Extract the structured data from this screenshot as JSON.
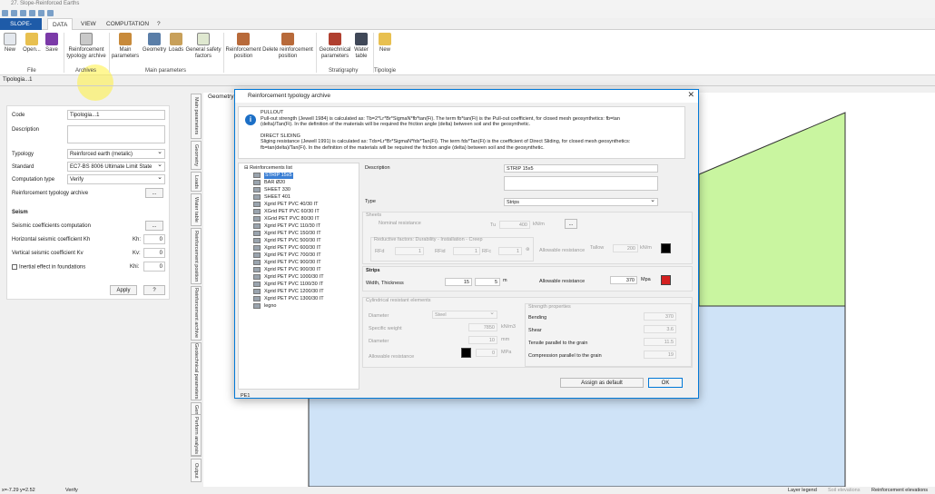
{
  "window": {
    "title": "27. Slope-Reinforced Earths"
  },
  "menu": {
    "file": "SLOPE-M.R.E.",
    "items": [
      "DATA",
      "VIEW",
      "COMPUTATION",
      "?"
    ]
  },
  "ribbon": {
    "buttons": [
      "New",
      "Open...",
      "Save",
      "Reinforcement typology archive",
      "Main parameters",
      "Geometry",
      "Loads",
      "General safety factors",
      "Reinforcement position",
      "Delete reinforcement position",
      "Geotechnical parameters",
      "Water table",
      "New"
    ],
    "groups": [
      "File",
      "Archives",
      "Main parameters",
      "Stratigraphy",
      "Tipologie"
    ]
  },
  "doc_tab": "Tipologia...1",
  "left_panel": {
    "code_label": "Code",
    "code_value": "Tipologia...1",
    "description_label": "Description",
    "typology_label": "Typology",
    "typology_value": "Reinforced earth (metalic)",
    "standard_label": "Standard",
    "standard_value": "EC7-BS 8006 Ultimate Limit State",
    "computation_label": "Computation type",
    "computation_value": "Verify",
    "archive_label": "Reinforcement typology archive",
    "archive_button": "...",
    "seism_title": "Seism",
    "seismic_comp_label": "Seismic coefficients computation",
    "seismic_comp_button": "...",
    "kh_label": "Horizontal seismic coefficient Kh",
    "kh_sym": "Kh:",
    "kh_value": "0",
    "kv_label": "Vertical seismic coefficient Kv",
    "kv_sym": "Kv:",
    "kv_value": "0",
    "inertial_label": "Inertial effect in foundations",
    "khi_sym": "Khi:",
    "khi_value": "0",
    "apply": "Apply",
    "help": "?"
  },
  "vertical_tabs": [
    "Main parameters",
    "Geometry",
    "Loads",
    "Water table",
    "Reinforcement position",
    "Reinforcement archive",
    "Geotechnical parameters",
    "General safety factors",
    "Perform analysis",
    "Output"
  ],
  "canvas_tab": "Geometry",
  "dialog": {
    "title": "Reinforcement typology archive",
    "info_lines": [
      "PULLOUT",
      "Pull-out strength (Jewell 1984) is calculated as: Tb=2*Lr*Br*SigmaN*fb*tan(Fi). The term fb*tan(Fi) is the Pull-out coefficient, for closed mesh geosynthetics: fb=tan",
      "(delta)/Tan(Fi). In the definition  of the materials will be required the friction angle (delta) between soil and the geosynthetic.",
      "",
      "DIRECT SLIDING",
      "Sliging resistance (Jewell 1991) is calculated as: Tds=Lr*Br*SigmaN*fds*Tan(Fi). The term fds*Tan(Fi) is the coefficient of Direct Sliding,  for closed mesh geosynthetics:",
      "fb=tan(delta)/Tan(Fi). In the definition  of the materials will be required the friction angle (delta) between soil and the geosynthetic."
    ],
    "tree_root": "Reinforcements list",
    "tree_items": [
      "STRIP 15x5",
      "BAR Ø20",
      "SHEET 330",
      "SHEET 401",
      "Xgrid PET PVC 40/30 IT",
      "XGrid PET PVC 60/30 IT",
      "XGrid PET PVC 80/30 IT",
      "Xgrid PET PVC 110/30 IT",
      "Xgrid PET PVC 150/30 IT",
      "Xgrid PET PVC 500/30 IT",
      "Xgrid PET PVC 600/30 IT",
      "Xgrid PET PVC 700/30 IT",
      "Xgrid PET PVC 900/30 IT",
      "Xgrid PET PVC 900/30 IT",
      "Xgrid PET PVC 1000/30 IT",
      "Xgrid PET PVC 1100/30 IT",
      "Xgrid PET PVC 1200/30 IT",
      "Xgrid PET PVC 1300/30 IT",
      "legno"
    ],
    "description_label": "Description",
    "description_value": "STRIP 15x5",
    "type_label": "Type",
    "type_value": "Strips",
    "sheets_title": "Sheets",
    "nominal_label": "Nominal resistance",
    "tu_sym": "Tu",
    "tu_value": "400",
    "tu_unit": "kN/m",
    "dots": "...",
    "reductive_title": "Reductive factors: Durability - Installation - Creep",
    "rfd_label": "RFd",
    "rfd_value": "1",
    "rfid_label": "RFid",
    "rfid_value": "1",
    "rfc_label": "RFc",
    "rfc_value": "1",
    "allow_sheet_label": "Allowable resistance",
    "tallow_sym": "Tallow",
    "tallow_value": "200",
    "tallow_unit": "kN/m",
    "strips_title": "Strips",
    "width_label": "Width, Thickness",
    "width_value": "15",
    "thickness_value": "5",
    "mm_unit": "m",
    "allow_strip_label": "Allowable resistance",
    "allow_strip_value": "370",
    "allow_strip_unit": "Mpa",
    "cyl_title": "Cylindrical resistant elements",
    "diameter_label": "Diameter",
    "diameter_value": "Steel",
    "specific_weight_label": "Specific weight",
    "sw_value": "7850",
    "sw_unit": "kN/m3",
    "diameter2_label": "Diameter",
    "d2_value": "10",
    "d2_unit": "mm",
    "allow_cyl_label": "Allowable resistance",
    "allow_cyl_value": "0",
    "allow_cyl_unit": "MPa",
    "strength_title": "Strength properties",
    "bending_label": "Bending",
    "bending_value": "370",
    "shear_label": "Shear",
    "shear_value": "3.6",
    "tensile_label": "Tensile parallel to the grain",
    "tensile_value": "11.5",
    "compression_label": "Compression parallel to the grain",
    "compression_value": "19",
    "assign_default": "Assign as default",
    "ok": "OK",
    "footer": "PE1"
  },
  "status": {
    "coords": "x=-7.29 y=2.52",
    "mode": "Verify",
    "layer_legend": "Layer legend",
    "soil_elevations": "Soil elevations",
    "reinf_elevations": "Reinforcement elevations"
  },
  "colors": {
    "accent": "#1e5ba8",
    "strip_swatch": "#d42020",
    "black_swatch": "#000000",
    "green_area": "#c9f5a0",
    "blue_area": "#cfe3f7"
  }
}
